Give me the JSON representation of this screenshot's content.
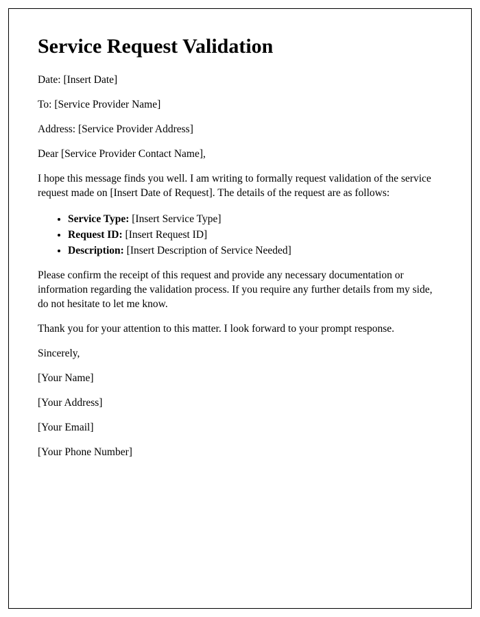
{
  "title": "Service Request Validation",
  "fields": {
    "date_label": "Date:",
    "date_value": "[Insert Date]",
    "to_label": "To:",
    "to_value": "[Service Provider Name]",
    "address_label": "Address:",
    "address_value": "[Service Provider Address]"
  },
  "salutation": "Dear [Service Provider Contact Name],",
  "body1": "I hope this message finds you well. I am writing to formally request validation of the service request made on [Insert Date of Request]. The details of the request are as follows:",
  "list": {
    "item1_label": "Service Type:",
    "item1_value": "[Insert Service Type]",
    "item2_label": "Request ID:",
    "item2_value": "[Insert Request ID]",
    "item3_label": "Description:",
    "item3_value": "[Insert Description of Service Needed]"
  },
  "body2": "Please confirm the receipt of this request and provide any necessary documentation or information regarding the validation process. If you require any further details from my side, do not hesitate to let me know.",
  "body3": "Thank you for your attention to this matter. I look forward to your prompt response.",
  "closing": "Sincerely,",
  "signature": {
    "name": "[Your Name]",
    "address": "[Your Address]",
    "email": "[Your Email]",
    "phone": "[Your Phone Number]"
  }
}
